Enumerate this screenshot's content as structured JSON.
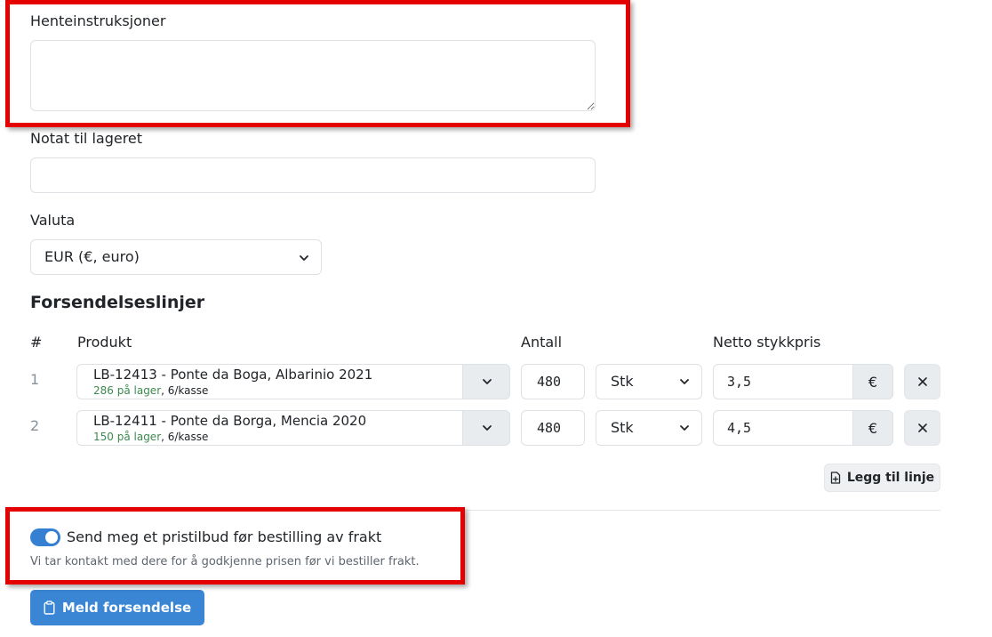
{
  "form": {
    "pickup_label": "Henteinstruksjoner",
    "pickup_value": "",
    "warehouse_label": "Notat til lageret",
    "warehouse_value": "",
    "currency_label": "Valuta",
    "currency_value": "EUR (€, euro)"
  },
  "lines": {
    "title": "Forsendelseslinjer",
    "headers": {
      "num": "#",
      "product": "Produkt",
      "quantity": "Antall",
      "price": "Netto stykkpris"
    },
    "rows": [
      {
        "num": "1",
        "product": "LB-12413 - Ponte da Boga, Albarinio 2021",
        "stock": "286 på lager",
        "pack": ", 6/kasse",
        "quantity": "480",
        "unit": "Stk",
        "price": "3,5",
        "currency_symbol": "€"
      },
      {
        "num": "2",
        "product": "LB-12411 - Ponte da Borga, Mencia 2020",
        "stock": "150 på lager",
        "pack": ", 6/kasse",
        "quantity": "480",
        "unit": "Stk",
        "price": "4,5",
        "currency_symbol": "€"
      }
    ],
    "add_line_label": "Legg til linje"
  },
  "quote": {
    "toggle_on": true,
    "label": "Send meg et pristilbud før bestilling av frakt",
    "help": "Vi tar kontakt med dere for å godkjenne prisen før vi bestiller frakt."
  },
  "submit_label": "Meld forsendelse",
  "colors": {
    "primary": "#3a86d5",
    "highlight": "#e50000",
    "stock_text": "#3d8a4f"
  }
}
